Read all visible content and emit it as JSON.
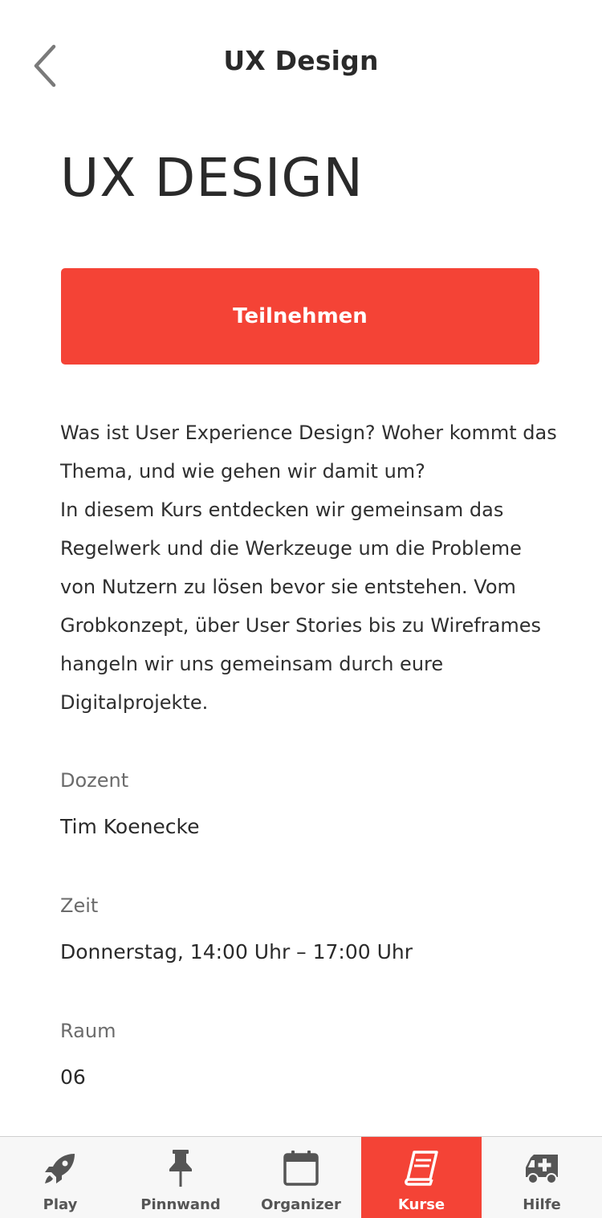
{
  "header": {
    "title": "UX Design",
    "back_icon": "chevron-left-icon"
  },
  "page": {
    "title": "UX DESIGN",
    "join_label": "Teilnehmen",
    "description": "Was ist User Experience Design? Woher kommt das Thema, und wie gehen wir damit um?\nIn diesem Kurs entdecken wir gemeinsam das Regelwerk und die Werkzeuge um die Probleme von Nutzern zu lösen bevor sie entstehen. Vom Grobkonzept, über User Stories bis zu Wireframes hangeln wir uns gemeinsam durch eure Digitalprojekte."
  },
  "info": {
    "lecturer_label": "Dozent",
    "lecturer_value": "Tim Koenecke",
    "time_label": "Zeit",
    "time_value": "Donnerstag, 14:00 Uhr – 17:00 Uhr",
    "room_label": "Raum",
    "room_value": "06"
  },
  "tabbar": {
    "active": "Kurse",
    "accent_color": "#f44336",
    "items": [
      {
        "label": "Play",
        "icon": "rocket-icon"
      },
      {
        "label": "Pinnwand",
        "icon": "pin-icon"
      },
      {
        "label": "Organizer",
        "icon": "calendar-icon"
      },
      {
        "label": "Kurse",
        "icon": "book-icon"
      },
      {
        "label": "Hilfe",
        "icon": "ambulance-icon"
      }
    ]
  }
}
